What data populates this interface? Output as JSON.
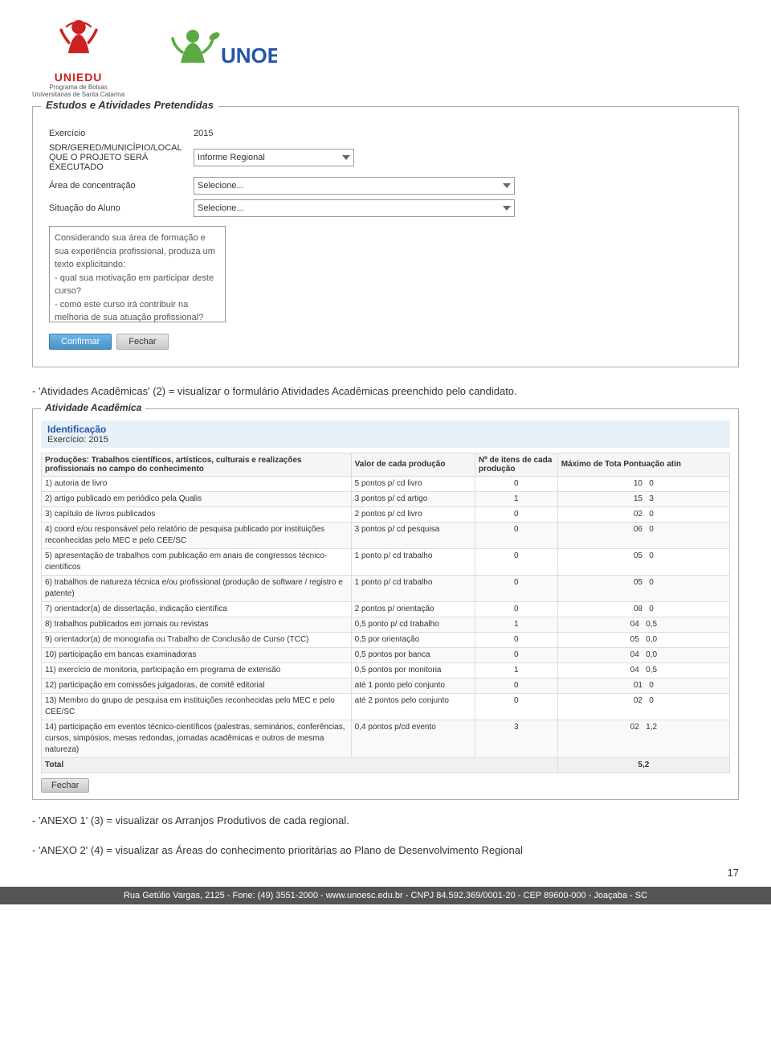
{
  "header": {
    "uniedu_line1": "UNIEDU",
    "uniedu_line2": "Programa de Bolsas",
    "uniedu_line3": "Universitárias de Santa Catarina",
    "unoesc": "UNOESC"
  },
  "estudos_section": {
    "title": "Estudos e Atividades Pretendidas",
    "fields": {
      "exercicio_label": "Exercício",
      "exercicio_value": "2015",
      "sdr_label": "SDR/GERED/MUNICÍPIO/LOCAL QUE O PROJETO SERÁ EXECUTADO",
      "sdr_placeholder": "Informe Regional",
      "area_label": "Área de concentração",
      "area_placeholder": "Selecione...",
      "situacao_label": "Situação do Aluno",
      "situacao_placeholder": "Selecione...",
      "textarea_text": "Considerando sua área de formação e sua experiência profissional, produza um texto explicitando:\n- qual sua motivação em participar deste curso?\n- como este curso irá contribuir na melhoria de sua atuação profissional?"
    },
    "btn_confirmar": "Confirmar",
    "btn_fechar": "Fechar"
  },
  "desc1": {
    "text": "- 'Atividades Acadêmicas' (2) = visualizar o formulário Atividades Acadêmicas preenchido pelo candidato."
  },
  "atividade_section": {
    "title": "Atividade Acadêmica",
    "identificacao_title": "Identificação",
    "exercicio_label": "Exercício:",
    "exercicio_value": "2015",
    "table": {
      "headers": [
        "Produções: Trabalhos científicos, artísticos, culturais e realizações profissionais no campo do conhecimento",
        "Valor de cada produção",
        "Nº de itens de cada produção",
        "Máximo de Tota Pontuação atin"
      ],
      "rows": [
        {
          "desc": "1) autoria de livro",
          "valor": "5 pontos p/ cd livro",
          "itens": "0",
          "max": "10",
          "total": "0"
        },
        {
          "desc": "2) artigo publicado em periódico pela Qualis",
          "valor": "3 pontos p/ cd artigo",
          "itens": "1",
          "max": "15",
          "total": "3"
        },
        {
          "desc": "3) capítulo de livros publicados",
          "valor": "2 pontos p/ cd livro",
          "itens": "0",
          "max": "02",
          "total": "0"
        },
        {
          "desc": "4) coord e/ou responsável pelo relatório de pesquisa publicado por instituições reconhecidas pelo MEC e pelo CEE/SC",
          "valor": "3 pontos p/ cd pesquisa",
          "itens": "0",
          "max": "06",
          "total": "0"
        },
        {
          "desc": "5) apresentação de trabalhos com publicação em anais de congressos técnico-científicos",
          "valor": "1 ponto p/ cd trabalho",
          "itens": "0",
          "max": "05",
          "total": "0"
        },
        {
          "desc": "6) trabalhos de natureza técnica e/ou profissional (produção de software / registro e patente)",
          "valor": "1 ponto p/ cd trabalho",
          "itens": "0",
          "max": "05",
          "total": "0"
        },
        {
          "desc": "7) orientador(a) de dissertação, indicação científica",
          "valor": "2 pontos p/ orientação",
          "itens": "0",
          "max": "08",
          "total": "0"
        },
        {
          "desc": "8) trabalhos publicados em jornais ou revistas",
          "valor": "0,5 ponto p/ cd trabalho",
          "itens": "1",
          "max": "04",
          "total": "0,5"
        },
        {
          "desc": "9) orientador(a) de monografia ou Trabalho de Conclusão de Curso (TCC)",
          "valor": "0,5 por orientação",
          "itens": "0",
          "max": "05",
          "total": "0,0"
        },
        {
          "desc": "10) participação em bancas examinadoras",
          "valor": "0,5 pontos por banca",
          "itens": "0",
          "max": "04",
          "total": "0,0"
        },
        {
          "desc": "11) exercício de monitoria, participação em programa de extensão",
          "valor": "0,5 pontos por monitoria",
          "itens": "1",
          "max": "04",
          "total": "0,5"
        },
        {
          "desc": "12) participação em comissões julgadoras, de comitê editorial",
          "valor": "até 1 ponto pelo conjunto",
          "itens": "0",
          "max": "01",
          "total": "0"
        },
        {
          "desc": "13) Membro do grupo de pesquisa em instituições reconhecidas pelo MEC e pelo CEE/SC",
          "valor": "até 2 pontos pelo conjunto",
          "itens": "0",
          "max": "02",
          "total": "0"
        },
        {
          "desc": "14) participação em eventos técnico-científicos (palestras, seminários, conferências, cursos, simpósios, mesas redondas, jornadas acadêmicas e outros de mesma natureza)",
          "valor": "0,4 pontos p/cd evento",
          "itens": "3",
          "max": "02",
          "total": "1,2"
        }
      ],
      "total_label": "Total",
      "total_value": "5,2"
    },
    "btn_fechar": "Fechar"
  },
  "desc2": {
    "text": "- 'ANEXO 1' (3) = visualizar os Arranjos Produtivos de cada regional."
  },
  "desc3": {
    "text": "- 'ANEXO 2' (4) = visualizar as Áreas do conhecimento prioritárias ao Plano de Desenvolvimento Regional"
  },
  "page_number": "17",
  "footer": {
    "text": "Rua Getúlio Vargas, 2125 - Fone: (49) 3551-2000 - www.unoesc.edu.br - CNPJ 84.592.369/0001-20 - CEP 89600-000 - Joaçaba - SC"
  }
}
